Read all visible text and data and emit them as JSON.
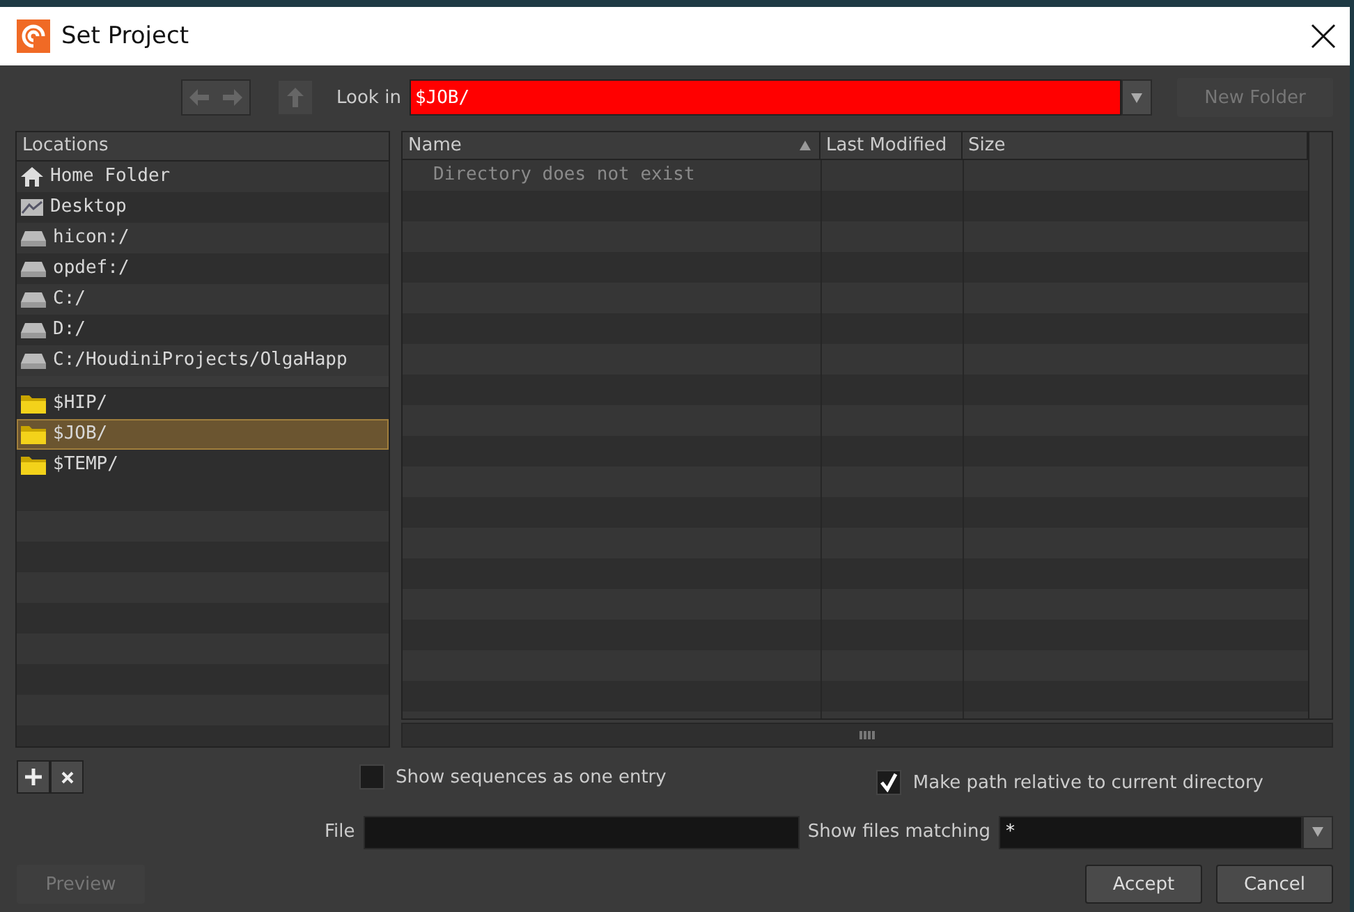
{
  "window": {
    "title": "Set Project"
  },
  "toolbar": {
    "look_in_label": "Look in",
    "look_in_value": "$JOB/",
    "look_in_invalid": true,
    "new_folder": {
      "label": "New Folder",
      "disabled": true
    }
  },
  "locations": {
    "header": "Locations",
    "groups": [
      [
        {
          "label": "Home Folder",
          "kind": "home",
          "selected": false
        },
        {
          "label": "Desktop",
          "kind": "desktop",
          "selected": false
        },
        {
          "label": "hicon:/",
          "kind": "drive",
          "selected": false
        },
        {
          "label": "opdef:/",
          "kind": "drive",
          "selected": false
        },
        {
          "label": "C:/",
          "kind": "drive",
          "selected": false
        },
        {
          "label": "D:/",
          "kind": "drive",
          "selected": false
        },
        {
          "label": "C:/HoudiniProjects/OlgaHapp",
          "kind": "drive",
          "selected": false
        }
      ],
      [
        {
          "label": "$HIP/",
          "kind": "folder",
          "selected": false
        },
        {
          "label": "$JOB/",
          "kind": "folder",
          "selected": true
        },
        {
          "label": "$TEMP/",
          "kind": "folder",
          "selected": false
        }
      ]
    ]
  },
  "table": {
    "columns": [
      {
        "label": "Name",
        "sorted": true
      },
      {
        "label": "Last Modified",
        "sorted": false
      },
      {
        "label": "Size",
        "sorted": false
      }
    ],
    "message": "Directory does not exist"
  },
  "options": [
    {
      "label": "Show sequences as one entry",
      "checked": false
    },
    {
      "label": "Make path relative to current directory",
      "checked": true
    }
  ],
  "file": {
    "label": "File"
  },
  "filter": {
    "label": "Show files matching",
    "value": "*"
  },
  "buttons": [
    {
      "label": "Preview",
      "disabled": true
    },
    {
      "label": "Accept",
      "disabled": false
    },
    {
      "label": "Cancel",
      "disabled": false
    }
  ]
}
